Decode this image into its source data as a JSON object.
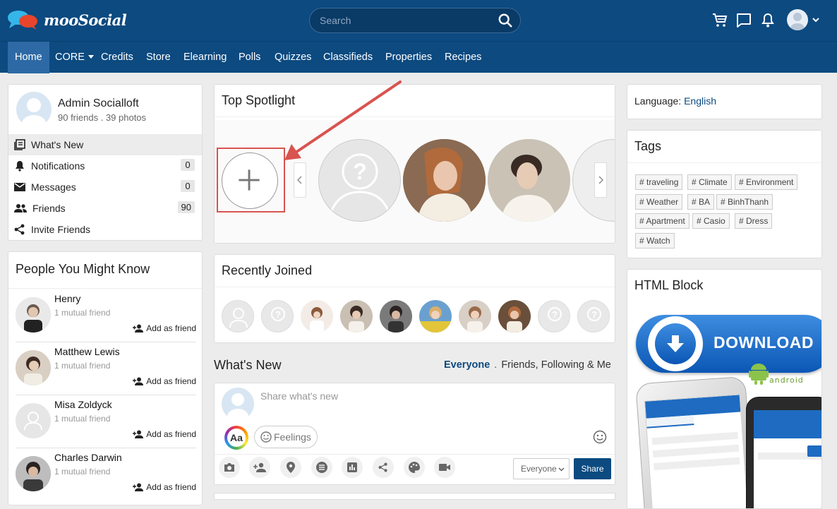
{
  "brand": {
    "name": "mooSocial"
  },
  "search": {
    "placeholder": "Search"
  },
  "nav": {
    "items": [
      "Home",
      "CORE",
      "Credits",
      "Store",
      "Elearning",
      "Polls",
      "Quizzes",
      "Classifieds",
      "Properties",
      "Recipes"
    ]
  },
  "profile": {
    "name": "Admin Socialloft",
    "stats": "90 friends . 39 photos"
  },
  "side_menu": [
    {
      "label": "What's New",
      "count": null
    },
    {
      "label": "Notifications",
      "count": "0"
    },
    {
      "label": "Messages",
      "count": "0"
    },
    {
      "label": "Friends",
      "count": "90"
    },
    {
      "label": "Invite Friends",
      "count": null
    }
  ],
  "people": {
    "title": "People You Might Know",
    "add_label": "Add as friend",
    "items": [
      {
        "name": "Henry",
        "mutual": "1 mutual friend"
      },
      {
        "name": "Matthew Lewis",
        "mutual": "1 mutual friend"
      },
      {
        "name": "Misa Zoldyck",
        "mutual": "1 mutual friend"
      },
      {
        "name": "Charles Darwin",
        "mutual": "1 mutual friend"
      }
    ]
  },
  "spotlight": {
    "title": "Top Spotlight"
  },
  "recently_joined": {
    "title": "Recently Joined"
  },
  "whats_new": {
    "title": "What's New",
    "filter_active": "Everyone",
    "filter_sep": ".",
    "filter_other": "Friends, Following & Me",
    "placeholder": "Share what's new",
    "feelings_label": "Feelings",
    "text_style_label": "Aa",
    "privacy_value": "Everyone",
    "share_label": "Share"
  },
  "language": {
    "label": "Language:",
    "value": "English"
  },
  "tags": {
    "title": "Tags",
    "items": [
      "# traveling",
      "# Climate",
      "# Environment",
      "# Weather",
      "# BA",
      "# BinhThanh",
      "# Apartment",
      "# Casio",
      "# Dress",
      "# Watch"
    ]
  },
  "html_block": {
    "title": "HTML Block",
    "download_label": "DOWNLOAD",
    "android_label": "android"
  },
  "colors": {
    "primary": "#0c4a80",
    "nav_active": "#2d6aa5",
    "highlight": "#d9534f",
    "link": "#0c4a80"
  }
}
